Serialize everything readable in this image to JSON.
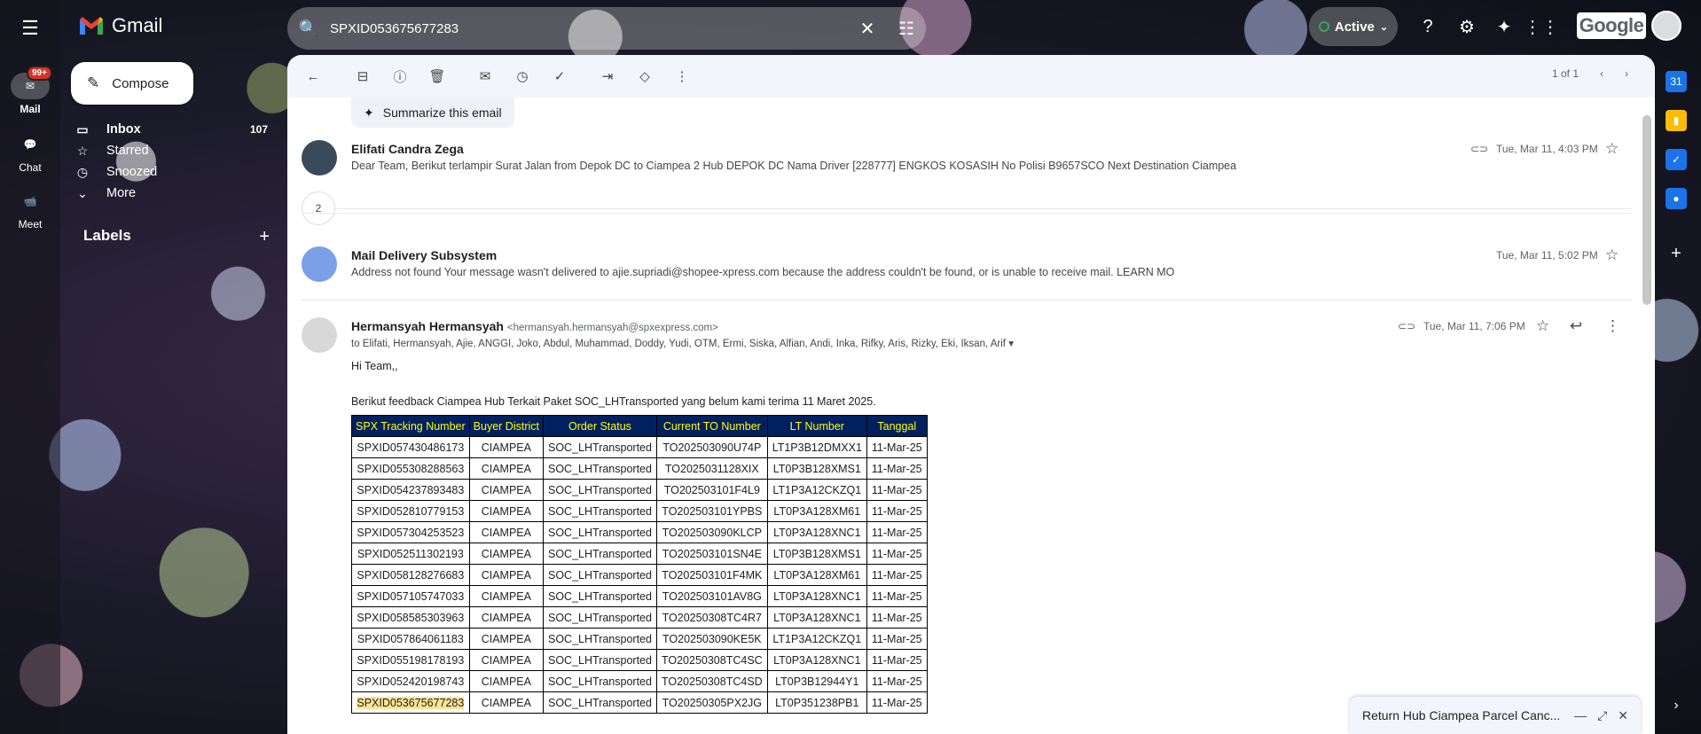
{
  "app": {
    "name": "Gmail"
  },
  "rail": {
    "mail_label": "Mail",
    "mail_badge": "99+",
    "chat_label": "Chat",
    "meet_label": "Meet"
  },
  "search": {
    "value": "SPXID053675677283"
  },
  "status": {
    "label": "Active"
  },
  "brand_box": "Google",
  "compose": {
    "label": "Compose"
  },
  "nav": [
    {
      "label": "Inbox",
      "count": "107",
      "icon": "inbox-icon"
    },
    {
      "label": "Starred",
      "icon": "star-icon"
    },
    {
      "label": "Snoozed",
      "icon": "clock-icon"
    },
    {
      "label": "More",
      "icon": "chevron-down-icon"
    }
  ],
  "labels": {
    "title": "Labels"
  },
  "pager": {
    "text": "1 of 1"
  },
  "summarize": {
    "label": "Summarize this email"
  },
  "messages": [
    {
      "sender": "Elifati Candra Zega",
      "snippet": "Dear Team, Berikut terlampir Surat Jalan from Depok DC to Ciampea 2 Hub DEPOK DC Nama Driver [228777] ENGKOS KOSASIH No Polisi B9657SCO Next Destination Ciampea",
      "date": "Tue, Mar 11, 4:03 PM"
    },
    {
      "collapsed_count": "2"
    },
    {
      "sender": "Mail Delivery Subsystem",
      "snippet": "Address not found Your message wasn't delivered to ajie.supriadi@shopee-xpress.com because the address couldn't be found, or is unable to receive mail. LEARN MO",
      "date": "Tue, Mar 11, 5:02 PM"
    },
    {
      "sender": "Hermansyah Hermansyah",
      "email": "<hermansyah.hermansyah@spxexpress.com>",
      "to": "to Elifati, Hermansyah, Ajie, ANGGI, Joko, Abdul, Muhammad, Doddy, Yudi, OTM, Ermi, Siska, Alfian, Andi, Inka, Rifky, Aris, Rizky, Eki, Iksan, Arif",
      "date": "Tue, Mar 11, 7:06 PM",
      "greeting": "Hi Team,,",
      "intro": "Berikut feedback Ciampea Hub Terkait Paket SOC_LHTransported yang belum kami terima 11 Maret 2025."
    }
  ],
  "table": {
    "headers": [
      "SPX Tracking Number",
      "Buyer District",
      "Order Status",
      "Current TO Number",
      "LT Number",
      "Tanggal"
    ],
    "rows": [
      [
        "SPXID057430486173",
        "CIAMPEA",
        "SOC_LHTransported",
        "TO202503090U74P",
        "LT1P3B12DMXX1",
        "11-Mar-25"
      ],
      [
        "SPXID055308288563",
        "CIAMPEA",
        "SOC_LHTransported",
        "TO2025031128XIX",
        "LT0P3B128XMS1",
        "11-Mar-25"
      ],
      [
        "SPXID054237893483",
        "CIAMPEA",
        "SOC_LHTransported",
        "TO202503101F4L9",
        "LT1P3A12CKZQ1",
        "11-Mar-25"
      ],
      [
        "SPXID052810779153",
        "CIAMPEA",
        "SOC_LHTransported",
        "TO202503101YPBS",
        "LT0P3A128XM61",
        "11-Mar-25"
      ],
      [
        "SPXID057304253523",
        "CIAMPEA",
        "SOC_LHTransported",
        "TO202503090KLCP",
        "LT0P3A128XNC1",
        "11-Mar-25"
      ],
      [
        "SPXID052511302193",
        "CIAMPEA",
        "SOC_LHTransported",
        "TO202503101SN4E",
        "LT0P3B128XMS1",
        "11-Mar-25"
      ],
      [
        "SPXID058128276683",
        "CIAMPEA",
        "SOC_LHTransported",
        "TO202503101F4MK",
        "LT0P3A128XM61",
        "11-Mar-25"
      ],
      [
        "SPXID057105747033",
        "CIAMPEA",
        "SOC_LHTransported",
        "TO202503101AV8G",
        "LT0P3A128XNC1",
        "11-Mar-25"
      ],
      [
        "SPXID058585303963",
        "CIAMPEA",
        "SOC_LHTransported",
        "TO20250308TC4R7",
        "LT0P3A128XNC1",
        "11-Mar-25"
      ],
      [
        "SPXID057864061183",
        "CIAMPEA",
        "SOC_LHTransported",
        "TO202503090KE5K",
        "LT1P3A12CKZQ1",
        "11-Mar-25"
      ],
      [
        "SPXID055198178193",
        "CIAMPEA",
        "SOC_LHTransported",
        "TO20250308TC4SC",
        "LT0P3A128XNC1",
        "11-Mar-25"
      ],
      [
        "SPXID052420198743",
        "CIAMPEA",
        "SOC_LHTransported",
        "TO20250308TC4SD",
        "LT0P3B12944Y1",
        "11-Mar-25"
      ],
      [
        "SPXID053675677283",
        "CIAMPEA",
        "SOC_LHTransported",
        "TO20250305PX2JG",
        "LT0P351238PB1",
        "11-Mar-25"
      ]
    ],
    "highlight_row": 12
  },
  "draft": {
    "title": "Return Hub Ciampea Parcel Canc..."
  },
  "colors": {
    "header_bg": "#002060",
    "header_text": "#ffff00",
    "highlight": "#fde293",
    "badge": "#d93025"
  }
}
